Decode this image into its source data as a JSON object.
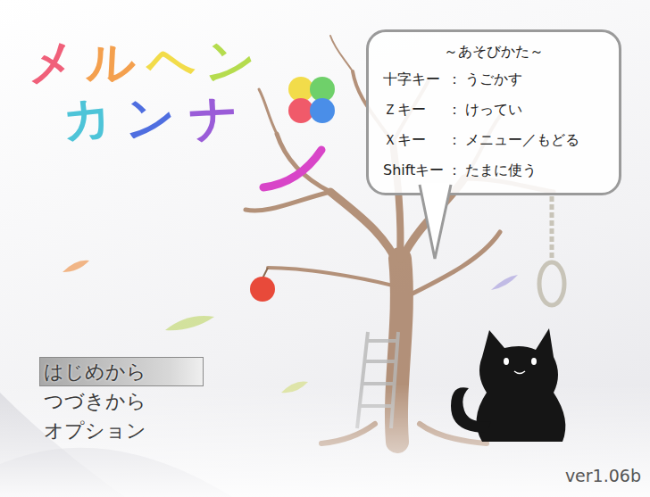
{
  "title": {
    "lines": [
      [
        {
          "char": "メ",
          "color": "#f0607a"
        },
        {
          "char": "ル",
          "color": "#f4a04e"
        },
        {
          "char": "ヘ",
          "color": "#f2dc4a"
        },
        {
          "char": "ン",
          "color": "#b5dc4e"
        }
      ],
      [
        {
          "char": "カ",
          "color": "#4ec4d8"
        },
        {
          "char": "ン",
          "color": "#4f6ee0"
        },
        {
          "char": "ナ",
          "color": "#9a5cd8"
        }
      ]
    ]
  },
  "help": {
    "heading": "～あそびかた～",
    "rows": [
      {
        "key": "十字キー",
        "sep": "：",
        "action": "うごかす"
      },
      {
        "key": "Ｚキー",
        "sep": "：",
        "action": "けってい"
      },
      {
        "key": "Ｘキー",
        "sep": "：",
        "action": "メニュー／もどる"
      },
      {
        "key": "Shiftキー",
        "sep": "：",
        "action": "たまに使う"
      }
    ]
  },
  "menu": [
    {
      "label": "はじめから",
      "selected": true
    },
    {
      "label": "つづきから",
      "selected": false
    },
    {
      "label": "オプション",
      "selected": false
    }
  ],
  "version": "ver1.06b"
}
